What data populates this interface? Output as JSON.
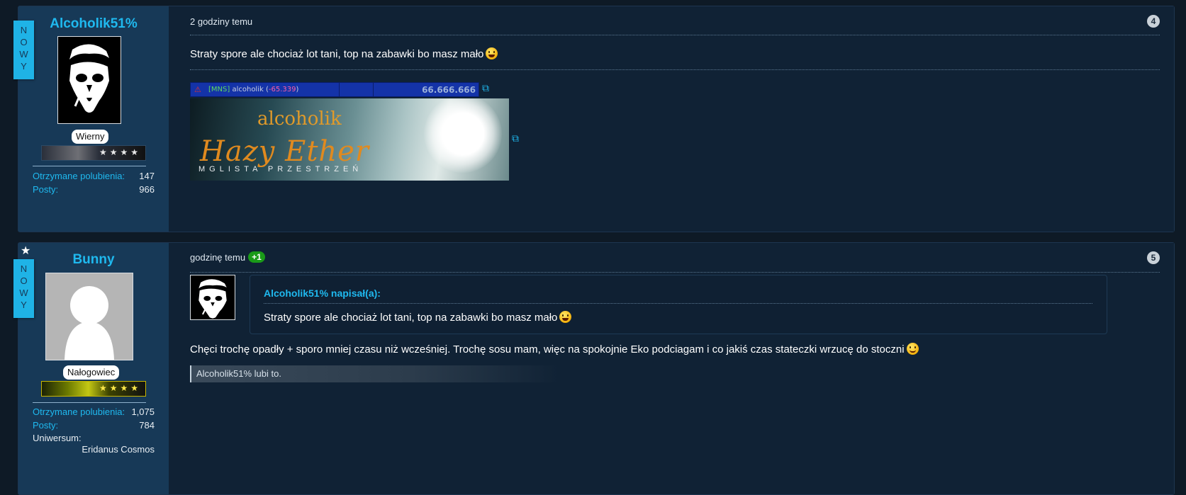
{
  "posts": [
    {
      "ribbon": "NOWY",
      "username": "Alcoholik51%",
      "rank": "Wierny",
      "stats": [
        {
          "label": "Otrzymane polubienia:",
          "value": "147"
        },
        {
          "label": "Posty:",
          "value": "966"
        }
      ],
      "timestamp": "2 godziny temu",
      "number": "4",
      "message": "Straty spore ale chociaż lot tani, top na zabawki bo masz mało",
      "signature": {
        "tag": "[MNS]",
        "name": "alcoholik",
        "delta": "-65.339",
        "score": "66.666.666",
        "banner_title": "alcoholik",
        "banner_main": "Hazy Ether",
        "banner_sub": "MGLISTA PRZESTRZEŃ"
      }
    },
    {
      "ribbon": "NOWY",
      "username": "Bunny",
      "rank": "Nałogowiec",
      "stats": [
        {
          "label": "Otrzymane polubienia:",
          "value": "1,075"
        },
        {
          "label": "Posty:",
          "value": "784"
        }
      ],
      "universe_label": "Uniwersum:",
      "universe_value": "Eridanus Cosmos",
      "timestamp": "godzinę temu",
      "reaction": "+1",
      "number": "5",
      "quote": {
        "author": "Alcoholik51% napisał(a):",
        "text": "Straty spore ale chociaż lot tani, top na zabawki bo masz mało"
      },
      "message": "Chęci trochę opadły + sporo mniej czasu niż wcześniej. Trochę sosu mam, więc na spokojnie Eko podciagam i co jakiś czas stateczki wrzucę do stoczni",
      "likes": "Alcoholik51% lubi to."
    }
  ],
  "icons": {
    "star": "star-icon",
    "external": "external-link-icon",
    "smiley_tongue": "tongue-smiley-icon",
    "smiley": "smile-icon"
  },
  "colors": {
    "accent": "#1fb9ef",
    "background": "#102235",
    "sidebar": "#173957",
    "reaction": "#1a9a18"
  }
}
